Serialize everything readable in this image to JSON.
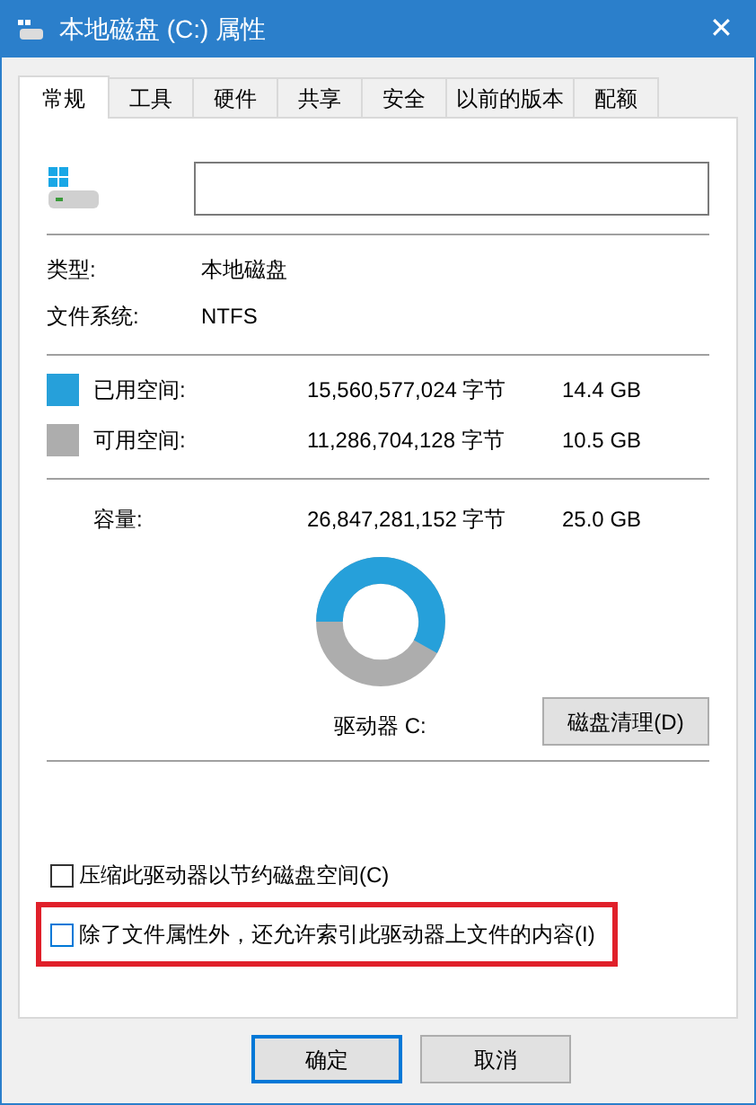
{
  "window": {
    "title": "本地磁盘 (C:) 属性",
    "close": "✕"
  },
  "tabs": [
    {
      "label": "常规",
      "selected": true
    },
    {
      "label": "工具",
      "selected": false
    },
    {
      "label": "硬件",
      "selected": false
    },
    {
      "label": "共享",
      "selected": false
    },
    {
      "label": "安全",
      "selected": false
    },
    {
      "label": "以前的版本",
      "selected": false
    },
    {
      "label": "配额",
      "selected": false
    }
  ],
  "info": [
    {
      "label": "类型:",
      "value": "本地磁盘"
    },
    {
      "label": "文件系统:",
      "value": "NTFS"
    }
  ],
  "space": [
    {
      "label": "已用空间:",
      "bytes": "15,560,577,024 字节",
      "size": "14.4 GB",
      "color": "#26a0da"
    },
    {
      "label": "可用空间:",
      "bytes": "11,286,704,128 字节",
      "size": "10.5 GB",
      "color": "#adadad"
    }
  ],
  "capacity": {
    "label": "容量:",
    "bytes": "26,847,281,152 字节",
    "size": "25.0 GB"
  },
  "drive_label": "驱动器 C:",
  "cleanup_button": "磁盘清理(D)",
  "options": [
    {
      "label": "压缩此驱动器以节约磁盘空间(C)",
      "checked": false,
      "highlighted": false
    },
    {
      "label": "除了文件属性外，还允许索引此驱动器上文件的内容(I)",
      "checked": false,
      "highlighted": true
    }
  ],
  "buttons": [
    {
      "label": "确定",
      "default": true
    },
    {
      "label": "取消",
      "default": false
    }
  ]
}
